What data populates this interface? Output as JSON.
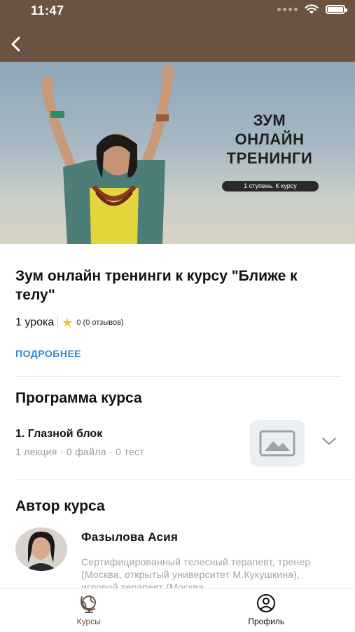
{
  "status_bar": {
    "time": "11:47"
  },
  "header": {
    "back_icon": "chevron-left-icon"
  },
  "banner": {
    "title_lines": [
      "ЗУМ",
      "ОНЛАЙН",
      "ТРЕНИНГИ"
    ],
    "pill": "1 ступень. К курсу"
  },
  "course": {
    "title": "Зум онлайн тренинги к курсу \"Ближе к телу\"",
    "lessons": "1 урока",
    "rating": "0 (0 отзывов)",
    "more": "ПОДРОБНЕЕ"
  },
  "program": {
    "title": "Программа курса",
    "modules": [
      {
        "title": "1. Глазной блок",
        "meta": "1 лекция · 0 файла · 0 тест"
      }
    ]
  },
  "author": {
    "section_title": "Автор курса",
    "name": "Фазылова Асия",
    "bio": "Сертифицированный телесный терапевт, тренер (Москва, открытый университет М.Кукушкина), игровой терапевт (Москва"
  },
  "tabbar": {
    "tabs": [
      {
        "label": "Курсы",
        "icon": "globe-icon",
        "active": true
      },
      {
        "label": "Профиль",
        "icon": "profile-icon",
        "active": false
      }
    ]
  },
  "colors": {
    "header": "#6a5343",
    "accent": "#2a86d6",
    "tab_active": "#6a5343",
    "star": "#f2c233"
  }
}
